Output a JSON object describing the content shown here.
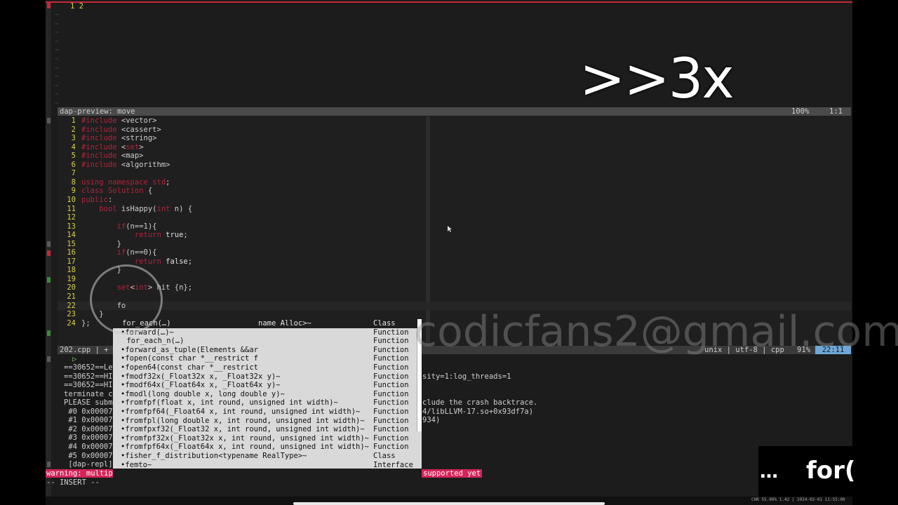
{
  "top_window": {
    "line_numbers": "1 2",
    "tilde": "~"
  },
  "overlay": {
    "speed": ">>3x",
    "dots": "…",
    "typed": "for("
  },
  "preview_bar": {
    "title": "dap-preview: move",
    "percent": "100%",
    "position": "1:1"
  },
  "code_lines": [
    {
      "n": "1",
      "text": "#include <vector>"
    },
    {
      "n": "2",
      "text": "#include <cassert>"
    },
    {
      "n": "3",
      "text": "#include <string>"
    },
    {
      "n": "4",
      "text": "#include <set>"
    },
    {
      "n": "5",
      "text": "#include <map>"
    },
    {
      "n": "6",
      "text": "#include <algorithm>"
    },
    {
      "n": "7",
      "text": ""
    },
    {
      "n": "8",
      "text": "using namespace std;"
    },
    {
      "n": "9",
      "text": "class Solution {"
    },
    {
      "n": "10",
      "text": "public:"
    },
    {
      "n": "11",
      "text": "    bool isHappy(int n) {"
    },
    {
      "n": "12",
      "text": ""
    },
    {
      "n": "13",
      "text": "        if(n==1){"
    },
    {
      "n": "14",
      "text": "            return true;"
    },
    {
      "n": "15",
      "text": "        }"
    },
    {
      "n": "16",
      "text": "        if(n==0){"
    },
    {
      "n": "17",
      "text": "            return false;"
    },
    {
      "n": "18",
      "text": "        }"
    },
    {
      "n": "19",
      "text": ""
    },
    {
      "n": "20",
      "text": "        set<int> hit {n};"
    },
    {
      "n": "21",
      "text": ""
    },
    {
      "n": "22",
      "text": "        fo"
    },
    {
      "n": "23",
      "text": "    }"
    },
    {
      "n": "24",
      "text": "};"
    }
  ],
  "status": {
    "file": "202.cpp | +",
    "encoding": "unix | utf-8 | cpp",
    "percent": "91%",
    "position": "22:11"
  },
  "repl_lines": [
    {
      "left": "==30652==Le",
      "right": ""
    },
    {
      "left": "==30652==HI",
      "right": "sity=1:log_threads=1"
    },
    {
      "left": "==30652==HI",
      "right": ""
    },
    {
      "left": "terminate c",
      "right": ""
    },
    {
      "left": "PLEASE subm",
      "right": "clude the crash backtrace."
    },
    {
      "left": " #0 0x00007",
      "right": "4/libLLVM-17.so+0x93df7a)"
    },
    {
      "left": " #1 0x00007",
      "right": "934)"
    },
    {
      "left": " #2 0x00007",
      "right": ""
    },
    {
      "left": " #3 0x00007",
      "right": ""
    },
    {
      "left": " #4 0x00007",
      "right": ""
    },
    {
      "left": " #5 0x00007",
      "right": ""
    },
    {
      "left": " [dap-repl]",
      "right": ""
    }
  ],
  "repl_play": "▷",
  "completion": [
    {
      "word": "for_each(…)",
      "extra": "name Alloc>~",
      "kind": "Class",
      "selected": true
    },
    {
      "word": "•forward(…)~",
      "extra": "",
      "kind": "Function",
      "selected": false
    },
    {
      "word": " for_each_n(…)",
      "extra": "",
      "kind": "Function",
      "selected": false
    },
    {
      "word": "•forward_as_tuple(Elements &&ar",
      "extra": "",
      "kind": "Function",
      "selected": false
    },
    {
      "word": "•fopen(const char *__restrict f",
      "extra": "",
      "kind": "Function",
      "selected": false
    },
    {
      "word": "•fopen64(const char *__restrict",
      "extra": "",
      "kind": "Function",
      "selected": false
    },
    {
      "word": "•fmodf32x(_Float32x x, _Float32x y)~",
      "extra": "",
      "kind": "Function",
      "selected": false
    },
    {
      "word": "•fmodf64x(_Float64x x, _Float64x y)~",
      "extra": "",
      "kind": "Function",
      "selected": false
    },
    {
      "word": "•fmodl(long double x, long double y)~",
      "extra": "",
      "kind": "Function",
      "selected": false
    },
    {
      "word": "•fromfpf(float x, int round, unsigned int width)~",
      "extra": "",
      "kind": "Function",
      "selected": false
    },
    {
      "word": "•fromfpf64(_Float64 x, int round, unsigned int width)~",
      "extra": "",
      "kind": "Function",
      "selected": false
    },
    {
      "word": "•fromfpl(long double x, int round, unsigned int width)~",
      "extra": "",
      "kind": "Function",
      "selected": false
    },
    {
      "word": "•fromfpxf32(_Float32 x, int round, unsigned int width)~",
      "extra": "",
      "kind": "Function",
      "selected": false
    },
    {
      "word": "•fromfpf32x(_Float32x x, int round, unsigned int width)~",
      "extra": "",
      "kind": "Function",
      "selected": false
    },
    {
      "word": "•fromfpf64x(_Float64x x, int round, unsigned int width)~",
      "extra": "",
      "kind": "Function",
      "selected": false
    },
    {
      "word": "•fisher_f_distribution<typename RealType>~",
      "extra": "",
      "kind": "Class",
      "selected": false
    },
    {
      "word": "•femto~",
      "extra": "",
      "kind": "Interface",
      "selected": false
    }
  ],
  "messages": {
    "warning": "warning: multip",
    "supported": "supported yet",
    "mode": "-- INSERT --"
  },
  "watermark": "codicfans2@gmail.com",
  "bottom_right": "CHR 55.00% 1.42 | 2024-02-01 11:55:00",
  "colors": {
    "keyword": "#b0243b",
    "line_number": "#d7d04a",
    "accent_red": "#d4245a",
    "cursor_pos": "#6fa8d8"
  }
}
